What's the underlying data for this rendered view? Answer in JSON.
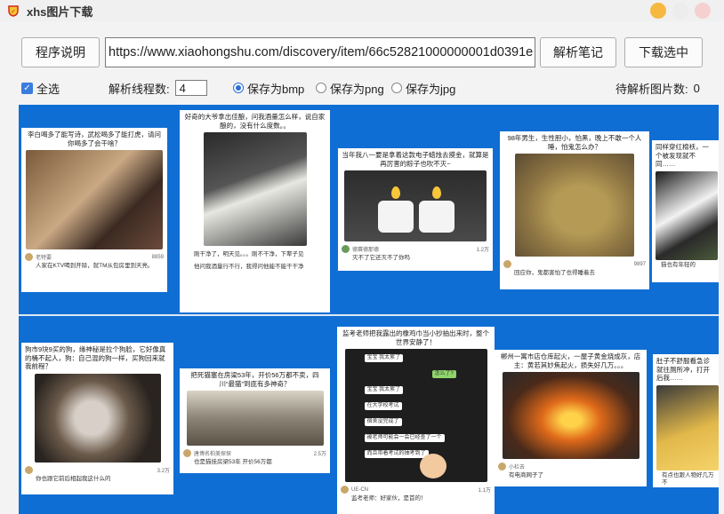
{
  "window": {
    "title": "xhs图片下载"
  },
  "toolbar": {
    "help_label": "程序说明",
    "url_value": "https://www.xiaohongshu.com/discovery/item/66c52821000000001d0391e",
    "parse_label": "解析笔记",
    "download_label": "下载选中"
  },
  "options": {
    "select_all_label": "全选",
    "threads_label": "解析线程数:",
    "threads_value": "4",
    "formats": [
      "保存为bmp",
      "保存为png",
      "保存为jpg"
    ],
    "selected_format": "保存为bmp",
    "pending_label": "待解析图片数:",
    "pending_count": "0"
  },
  "cards": [
    {
      "caption": "李白喝多了能写诗，武松喝多了能打虎，请问你喝多了会干啥？",
      "footer": "老特要",
      "stat": "8859",
      "comments": [
        "人家在KTV喝到开除，就TM从包房里到天亮。"
      ]
    },
    {
      "caption": "好奇的大爷拿出佳酿，问我酒量怎么样，说自家酿的，没有什么度数。。",
      "footer": "",
      "stat": "",
      "comments": [
        "刚干净了，明天见。。。刚不干净，下辈子见",
        "他问我酒量行不行，我得问他能不能干干净"
      ]
    },
    {
      "caption": "当年我八一要是拿着这款电子蜡烛去摸金，就算是再厉害的粽子也吹不灭~",
      "footer": "德赛德那德",
      "stat": "1.2万",
      "comments": [
        "灭不了它还灭不了你吗"
      ]
    },
    {
      "caption": "98年男生，生性胆小，怕黑，晚上不敢一个人睡，怕鬼怎么办？",
      "footer": "",
      "stat": "9897",
      "comments": [
        "回应你，鬼都害怕了也得睡着去"
      ]
    },
    {
      "caption": "同样穿红棉袄，一个被发现就不同……",
      "footer": "",
      "stat": "",
      "comments": [
        "猫也有年轻的"
      ]
    },
    {
      "caption": "狗市9块9买的狗，缘神秘是拉个狗脸，它好像真的桶不起人，狗：自己混的狗一样，买狗回来就我前程？",
      "footer": "",
      "stat": "3.2万",
      "comments": [
        "你也跟它前后相起我这什么的"
      ]
    },
    {
      "caption": "把死猫塞在房梁53年，开价56万都不卖，四川“最猫”到底有多神奇？",
      "footer": "唐博名柏美探探",
      "stat": "2.5万",
      "comments": [
        "也是猫挂房梁53年 开价56万都"
      ]
    },
    {
      "caption": "监考老师把我露出的橡鸡巾当小抄抽出来时，整个世界安静了！",
      "footer": "UE-CN",
      "stat": "1.1万",
      "comments": [
        "监考老师：好家伙，是首的！"
      ]
    },
    {
      "caption": "郴州一寓市店仓库起火，一屋子黄金烧成灰，店主：黄若其妙焦起火，损失好几万。。。",
      "footer": "小栏去",
      "stat": "",
      "comments": [
        "有电商网子了"
      ]
    },
    {
      "caption": "肚子不舒服看急诊就往厕所冲，打开后我……",
      "footer": "",
      "stat": "",
      "comments": [
        "有点也跟人物好几万不"
      ]
    }
  ],
  "chat_bubbles": [
    "宝宝 我太累了",
    "怎么了?",
    "宝宝 我太累了",
    "在大学校考试",
    "宿舍没完成了",
    "被老师可能会一会已经查了一个",
    "而且带着考试的抽考到了"
  ]
}
